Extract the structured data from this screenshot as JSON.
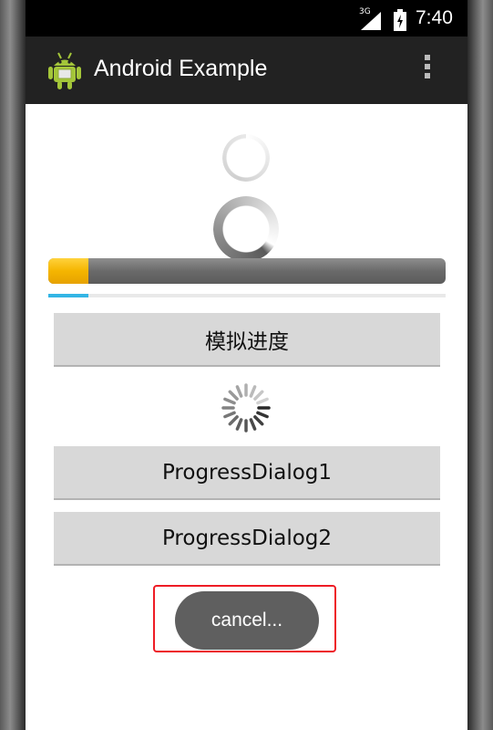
{
  "status_bar": {
    "network": "3G",
    "time": "7:40"
  },
  "action_bar": {
    "title": "Android Example",
    "icon": "android-robot-icon",
    "menu_icon": "overflow-menu-icon"
  },
  "progress": {
    "large_fraction": 0.1,
    "small_fraction": 0.1,
    "fill_color": "#f5b500",
    "small_fill_color": "#33b5e5"
  },
  "buttons": {
    "simulate_label": "模拟进度",
    "dialog1_label": "ProgressDialog1",
    "dialog2_label": "ProgressDialog2"
  },
  "toast": {
    "text": "cancel..."
  },
  "colors": {
    "action_bar": "#222222",
    "highlight": "#ee1c25"
  }
}
